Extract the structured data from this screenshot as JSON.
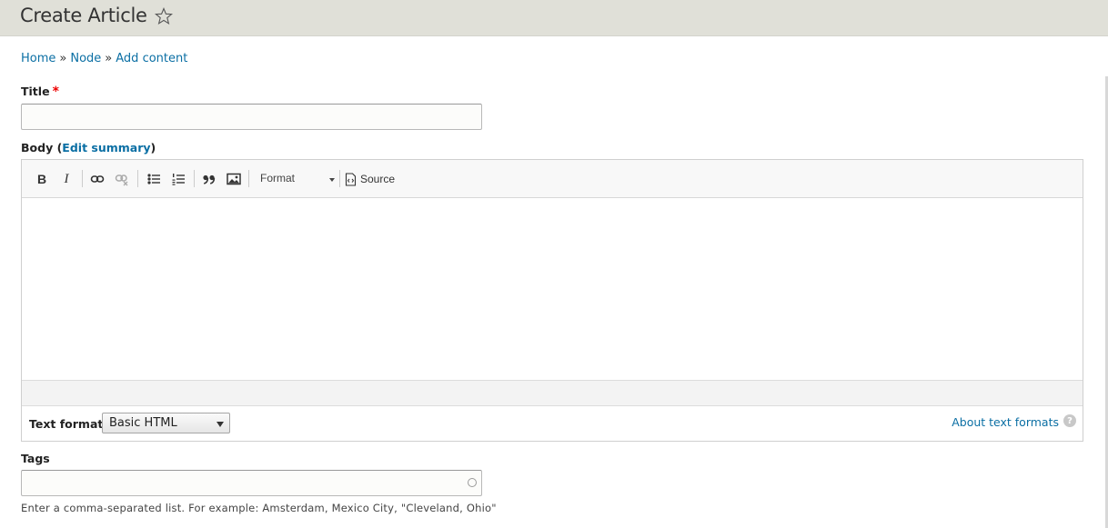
{
  "header": {
    "title": "Create Article",
    "star_icon": "star-outline-icon"
  },
  "breadcrumb": {
    "items": [
      {
        "label": "Home"
      },
      {
        "label": "Node"
      },
      {
        "label": "Add content"
      }
    ],
    "separator": "»"
  },
  "form": {
    "title_field": {
      "label": "Title",
      "required_marker": "*",
      "value": ""
    },
    "body_field": {
      "label": "Body",
      "paren_open": "(",
      "edit_summary_label": "Edit summary",
      "paren_close": ")",
      "toolbar": {
        "bold": "B",
        "italic": "I",
        "link_icon": "link-icon",
        "unlink_icon": "unlink-icon",
        "bulleted_list_icon": "bulleted-list-icon",
        "numbered_list_icon": "numbered-list-icon",
        "blockquote_icon": "blockquote-icon",
        "image_icon": "image-icon",
        "format_label": "Format",
        "source_label": "Source"
      },
      "content": "",
      "text_format": {
        "label": "Text format",
        "selected": "Basic HTML",
        "about_link": "About text formats",
        "help_glyph": "?"
      }
    },
    "tags_field": {
      "label": "Tags",
      "value": "",
      "description": "Enter a comma-separated list. For example: Amsterdam, Mexico City, \"Cleveland, Ohio\""
    }
  },
  "colors": {
    "link": "#0b6fa4",
    "header_bg": "#e0e0d8",
    "required": "#ee0000"
  }
}
